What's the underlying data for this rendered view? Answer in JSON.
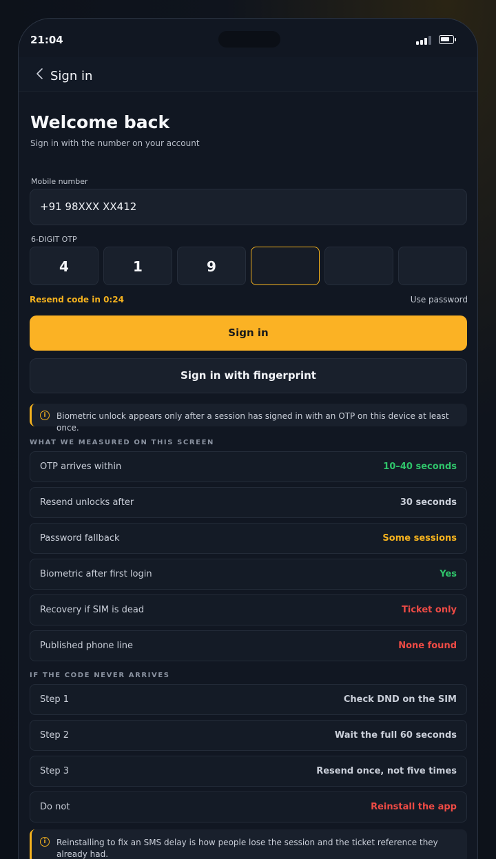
{
  "status_bar": {
    "time": "21:04"
  },
  "nav": {
    "title": "Sign in"
  },
  "header": {
    "title": "Welcome back",
    "subtitle": "Sign in with the number on your account"
  },
  "mobile": {
    "label": "Mobile number",
    "value": "+91 98XXX XX412"
  },
  "otp": {
    "label": "6-DIGIT OTP",
    "digits": [
      "4",
      "1",
      "9",
      "",
      "",
      ""
    ],
    "resend": "Resend code in 0:24",
    "use_password": "Use password"
  },
  "buttons": {
    "sign_in": "Sign in",
    "fingerprint": "Sign in with fingerprint"
  },
  "notice_biometric": "Biometric unlock appears only after a session has signed in with an OTP on this device at least once.",
  "measured": {
    "title": "WHAT WE MEASURED ON THIS SCREEN",
    "rows": [
      {
        "label": "OTP arrives within",
        "value": "10–40 seconds",
        "color": "#2fc46a"
      },
      {
        "label": "Resend unlocks after",
        "value": "30 seconds",
        "color": "#c9ced8"
      },
      {
        "label": "Password fallback",
        "value": "Some sessions",
        "color": "#f5b21e"
      },
      {
        "label": "Biometric after first login",
        "value": "Yes",
        "color": "#2fc46a"
      },
      {
        "label": "Recovery if SIM is dead",
        "value": "Ticket only",
        "color": "#ef4b45"
      },
      {
        "label": "Published phone line",
        "value": "None found",
        "color": "#ef4b45"
      }
    ]
  },
  "never_arrives": {
    "title": "IF THE CODE NEVER ARRIVES",
    "rows": [
      {
        "label": "Step 1",
        "value": "Check DND on the SIM",
        "color": "#c9ced8"
      },
      {
        "label": "Step 2",
        "value": "Wait the full 60 seconds",
        "color": "#c9ced8"
      },
      {
        "label": "Step 3",
        "value": "Resend once, not five times",
        "color": "#c9ced8"
      },
      {
        "label": "Do not",
        "value": "Reinstall the app",
        "color": "#ef4b45"
      }
    ]
  },
  "notice_reinstall": "Reinstalling to fix an SMS delay is how people lose the session and the ticket reference they already had.",
  "colors": {
    "accent": "#f5b21e",
    "success": "#2fc46a",
    "danger": "#ef4b45"
  },
  "icons": {
    "back": "chevron-left-icon",
    "info": "info-icon",
    "signal": "signal-icon",
    "battery": "battery-icon"
  }
}
